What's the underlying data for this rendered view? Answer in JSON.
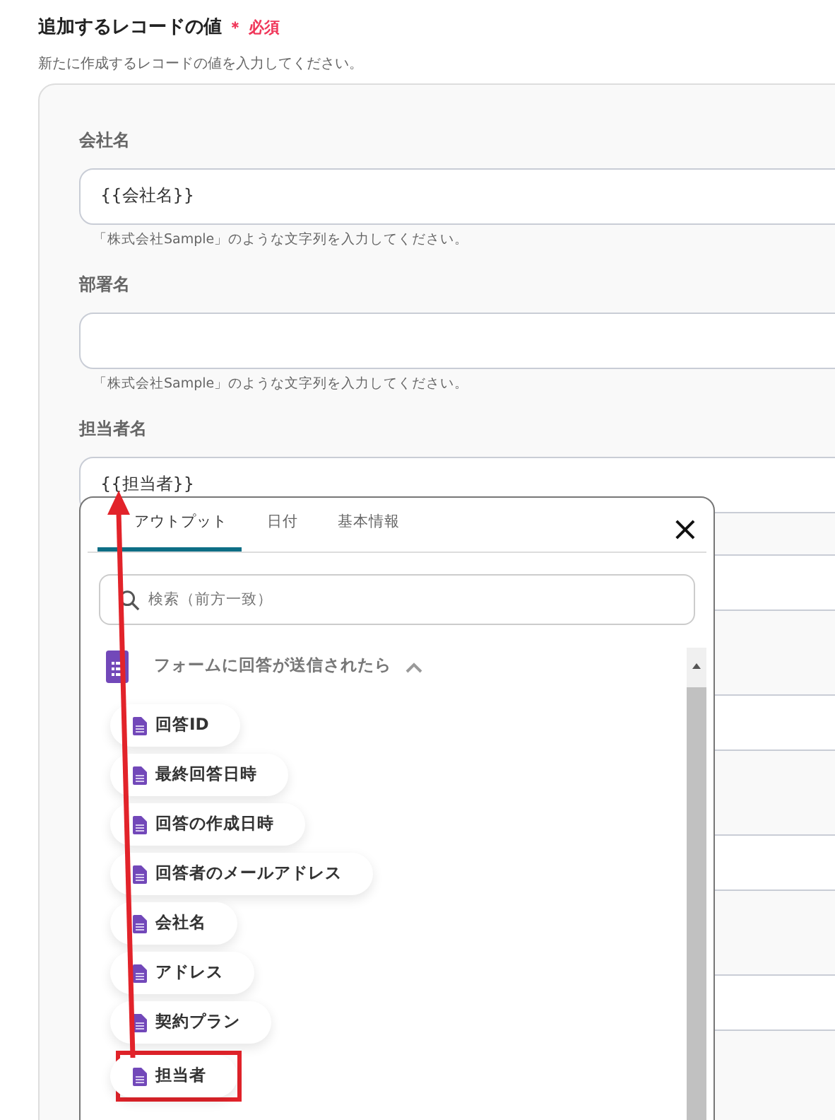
{
  "section": {
    "title": "追加するレコードの値",
    "required_mark": "＊",
    "required_label": "必須",
    "description": "新たに作成するレコードの値を入力してください。"
  },
  "fields": [
    {
      "label": "会社名",
      "value": "{{会社名}}",
      "help": "「株式会社Sample」のような文字列を入力してください。"
    },
    {
      "label": "部署名",
      "help": "「株式会社Sample」のような文字列を入力してください。"
    },
    {
      "label": "担当者名",
      "value": "{{担当者}}"
    }
  ],
  "covered_fields": [
    {
      "kind": "input"
    },
    {
      "kind": "input"
    },
    {
      "kind": "input"
    },
    {
      "kind": "input"
    }
  ],
  "popup": {
    "tabs": [
      {
        "label": "アウトプット",
        "selected": true
      },
      {
        "label": "日付",
        "selected": false
      },
      {
        "label": "基本情報",
        "selected": false
      }
    ],
    "close": "×",
    "search": {
      "placeholder": "検索（前方一致）"
    },
    "group": {
      "title": "フォームに回答が送信されたら",
      "expanded": true,
      "items": [
        {
          "label": "回答ID",
          "highlighted": false
        },
        {
          "label": "最終回答日時",
          "highlighted": false
        },
        {
          "label": "回答の作成日時",
          "highlighted": false
        },
        {
          "label": "回答者のメールアドレス",
          "highlighted": false
        },
        {
          "label": "会社名",
          "highlighted": false
        },
        {
          "label": "アドレス",
          "highlighted": false
        },
        {
          "label": "契約プラン",
          "highlighted": false
        },
        {
          "label": "担当者",
          "highlighted": true
        }
      ]
    }
  }
}
